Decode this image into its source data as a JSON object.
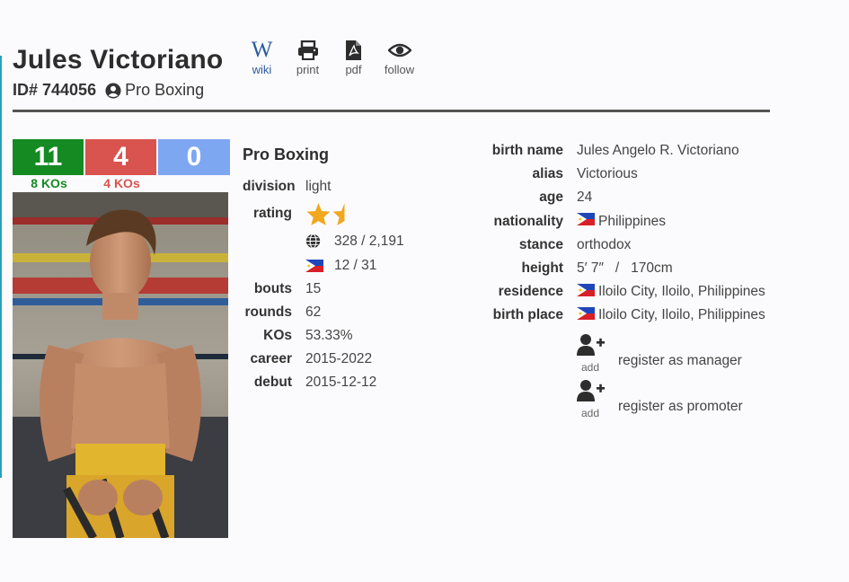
{
  "boxer": {
    "name": "Jules Victoriano",
    "id_label": "ID# 744056",
    "sport": "Pro Boxing"
  },
  "actions": [
    {
      "label": "wiki",
      "icon": "wikipedia-icon"
    },
    {
      "label": "print",
      "icon": "printer-icon"
    },
    {
      "label": "pdf",
      "icon": "pdf-icon"
    },
    {
      "label": "follow",
      "icon": "eye-icon"
    }
  ],
  "record": {
    "wins": "11",
    "losses": "4",
    "draws": "0",
    "win_kos": "8 KOs",
    "loss_kos": "4 KOs",
    "colors": {
      "win": "#158a22",
      "loss": "#d9534f",
      "draw": "#7ea7f1"
    }
  },
  "stats": {
    "title": "Pro Boxing",
    "division_label": "division",
    "division": "light",
    "rating_label": "rating",
    "rating_stars": 1.5,
    "world_rank": "328 / 2,191",
    "country_rank": "12 / 31",
    "bouts_label": "bouts",
    "bouts": "15",
    "rounds_label": "rounds",
    "rounds": "62",
    "kos_label": "KOs",
    "kos": "53.33%",
    "career_label": "career",
    "career": "2015-2022",
    "debut_label": "debut",
    "debut": "2015-12-12"
  },
  "bio": {
    "birth_name_label": "birth name",
    "birth_name": "Jules Angelo R. Victoriano",
    "alias_label": "alias",
    "alias": "Victorious",
    "age_label": "age",
    "age": "24",
    "nationality_label": "nationality",
    "nationality": "Philippines",
    "stance_label": "stance",
    "stance": "orthodox",
    "height_label": "height",
    "height": "5′ 7″   /   170cm",
    "residence_label": "residence",
    "residence": "Iloilo City, Iloilo, Philippines",
    "birth_place_label": "birth place",
    "birth_place": "Iloilo City, Iloilo, Philippines"
  },
  "register": {
    "add_label": "add",
    "manager": "register as manager",
    "promoter": "register as promoter"
  }
}
